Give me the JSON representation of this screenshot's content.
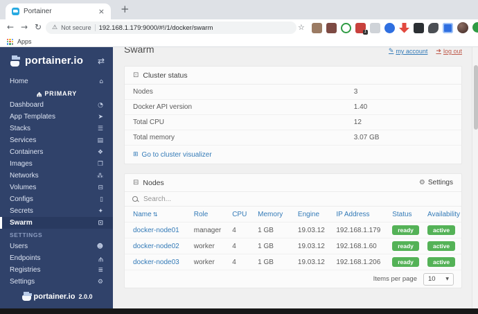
{
  "browser": {
    "tab_title": "Portainer",
    "new_tab": "+",
    "back_icon": "←",
    "forward_icon": "→",
    "reload_icon": "↻",
    "warning_icon": "⚠",
    "security_label": "Not secure",
    "url": "192.168.1.179:9000/#!/1/docker/swarm",
    "star_icon": "☆",
    "extension_badge": "1",
    "close_icon": "×",
    "apps_label": "Apps"
  },
  "colors": {
    "sidebar_navy": "#30426a",
    "accent_blue": "#337ab7",
    "success_green": "#54b257",
    "logout_red": "#bf5a4b"
  },
  "icons": {
    "collapse": "⇄",
    "home": "⌂",
    "endpoint_plug": "Ψ",
    "cluster": "⊡",
    "visualizer": "⊞",
    "nodes": "⊟",
    "gear": "⚙",
    "sort": "⇅",
    "account": "✎",
    "logout": "➜",
    "chevron_down": "▼"
  },
  "sidebar": {
    "brand": "portainer.io",
    "version": "2.0.0",
    "home_label": "Home",
    "endpoint_name": "PRIMARY",
    "items": [
      {
        "label": "Dashboard",
        "icon": "◔"
      },
      {
        "label": "App Templates",
        "icon": "➤"
      },
      {
        "label": "Stacks",
        "icon": "☰"
      },
      {
        "label": "Services",
        "icon": "▤"
      },
      {
        "label": "Containers",
        "icon": "❖"
      },
      {
        "label": "Images",
        "icon": "❐"
      },
      {
        "label": "Networks",
        "icon": "⁂"
      },
      {
        "label": "Volumes",
        "icon": "⊟"
      },
      {
        "label": "Configs",
        "icon": "▯"
      },
      {
        "label": "Secrets",
        "icon": "✦"
      },
      {
        "label": "Swarm",
        "icon": "⊡"
      }
    ],
    "settings_header": "SETTINGS",
    "settings_items": [
      {
        "label": "Users",
        "icon": "☻"
      },
      {
        "label": "Endpoints",
        "icon": "Ψ"
      },
      {
        "label": "Registries",
        "icon": "≣"
      },
      {
        "label": "Settings",
        "icon": "⚙"
      }
    ]
  },
  "header": {
    "title": "Swarm",
    "my_account": "my account",
    "log_out": "log out"
  },
  "cluster_status": {
    "title": "Cluster status",
    "rows": [
      {
        "label": "Nodes",
        "value": "3"
      },
      {
        "label": "Docker API version",
        "value": "1.40"
      },
      {
        "label": "Total CPU",
        "value": "12"
      },
      {
        "label": "Total memory",
        "value": "3.07 GB"
      }
    ],
    "link_label": "Go to cluster visualizer"
  },
  "nodes_panel": {
    "title": "Nodes",
    "settings_label": "Settings",
    "search_placeholder": "Search...",
    "columns": [
      "Name",
      "Role",
      "CPU",
      "Memory",
      "Engine",
      "IP Address",
      "Status",
      "Availability"
    ],
    "rows": [
      {
        "name": "docker-node01",
        "role": "manager",
        "cpu": "4",
        "memory": "1 GB",
        "engine": "19.03.12",
        "ip": "192.168.1.179",
        "status": "ready",
        "availability": "active"
      },
      {
        "name": "docker-node02",
        "role": "worker",
        "cpu": "4",
        "memory": "1 GB",
        "engine": "19.03.12",
        "ip": "192.168.1.60",
        "status": "ready",
        "availability": "active"
      },
      {
        "name": "docker-node03",
        "role": "worker",
        "cpu": "4",
        "memory": "1 GB",
        "engine": "19.03.12",
        "ip": "192.168.1.206",
        "status": "ready",
        "availability": "active"
      }
    ],
    "footer": {
      "items_per_page_label": "Items per page",
      "page_size": "10"
    }
  }
}
